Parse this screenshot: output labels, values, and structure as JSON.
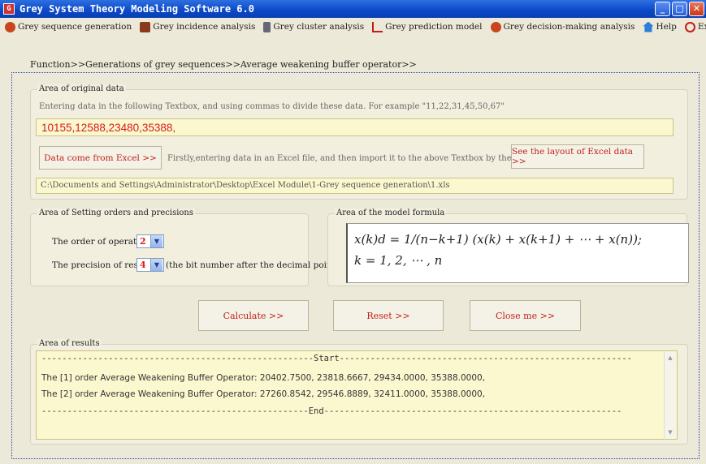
{
  "window": {
    "title": "Grey System Theory Modeling Software 6.0"
  },
  "menu": [
    {
      "label": "Grey sequence generation",
      "icon": "grey-sequence-icon",
      "color": "#c8461e"
    },
    {
      "label": "Grey incidence analysis",
      "icon": "grey-incidence-icon",
      "color": "#8a3a1a"
    },
    {
      "label": "Grey cluster analysis",
      "icon": "grey-cluster-icon",
      "color": "#556"
    },
    {
      "label": "Grey prediction model",
      "icon": "grey-prediction-icon",
      "color": "#c41c1c"
    },
    {
      "label": "Grey decision-making analysis",
      "icon": "grey-decision-icon",
      "color": "#c8461e"
    },
    {
      "label": "Help",
      "icon": "help-icon",
      "color": "#2a7fd8"
    },
    {
      "label": "Exit",
      "icon": "exit-icon",
      "color": "#c41c1c"
    }
  ],
  "breadcrumb": "Function>>Generations of grey sequences>>Average weakening buffer operator>>",
  "original_data": {
    "title": "Area of original data",
    "hint": "Entering data in the following Textbox, and using commas to divide these data. For example \"11,22,31,45,50,67\"",
    "value": "10155,12588,23480,35388,",
    "excel_button": "Data come from Excel >>",
    "excel_hint": "Firstly,entering data in an Excel file, and then import it to the above Textbox by the left button",
    "layout_button": "See the layout of Excel data >>",
    "path": "C:\\Documents and Settings\\Administrator\\Desktop\\Excel Module\\1-Grey sequence generation\\1.xls"
  },
  "settings": {
    "title": "Area of Setting orders and precisions",
    "order_label": "The order of operators",
    "order_value": "2",
    "precision_label": "The precision of results",
    "precision_value": "4",
    "precision_note": "(the bit number after the decimal point)"
  },
  "formula": {
    "title": "Area of the model formula",
    "line1": "x(k)d = 1/(n−k+1) (x(k) + x(k+1) + ⋯ + x(n));",
    "line2": "k = 1, 2, ⋯ , n"
  },
  "buttons": {
    "calculate": "Calculate >>",
    "reset": "Reset >>",
    "close": "Close me >>"
  },
  "results": {
    "title": "Area of results",
    "start_line": "-----------------------------------------------------Start---------------------------------------------------------",
    "lines": [
      "The [1] order Average Weakening Buffer Operator: 20402.7500, 23818.6667, 29434.0000, 35388.0000,",
      "The [2] order Average Weakening Buffer Operator: 27260.8542, 29546.8889, 32411.0000, 35388.0000,"
    ],
    "end_line": "----------------------------------------------------End----------------------------------------------------------"
  }
}
